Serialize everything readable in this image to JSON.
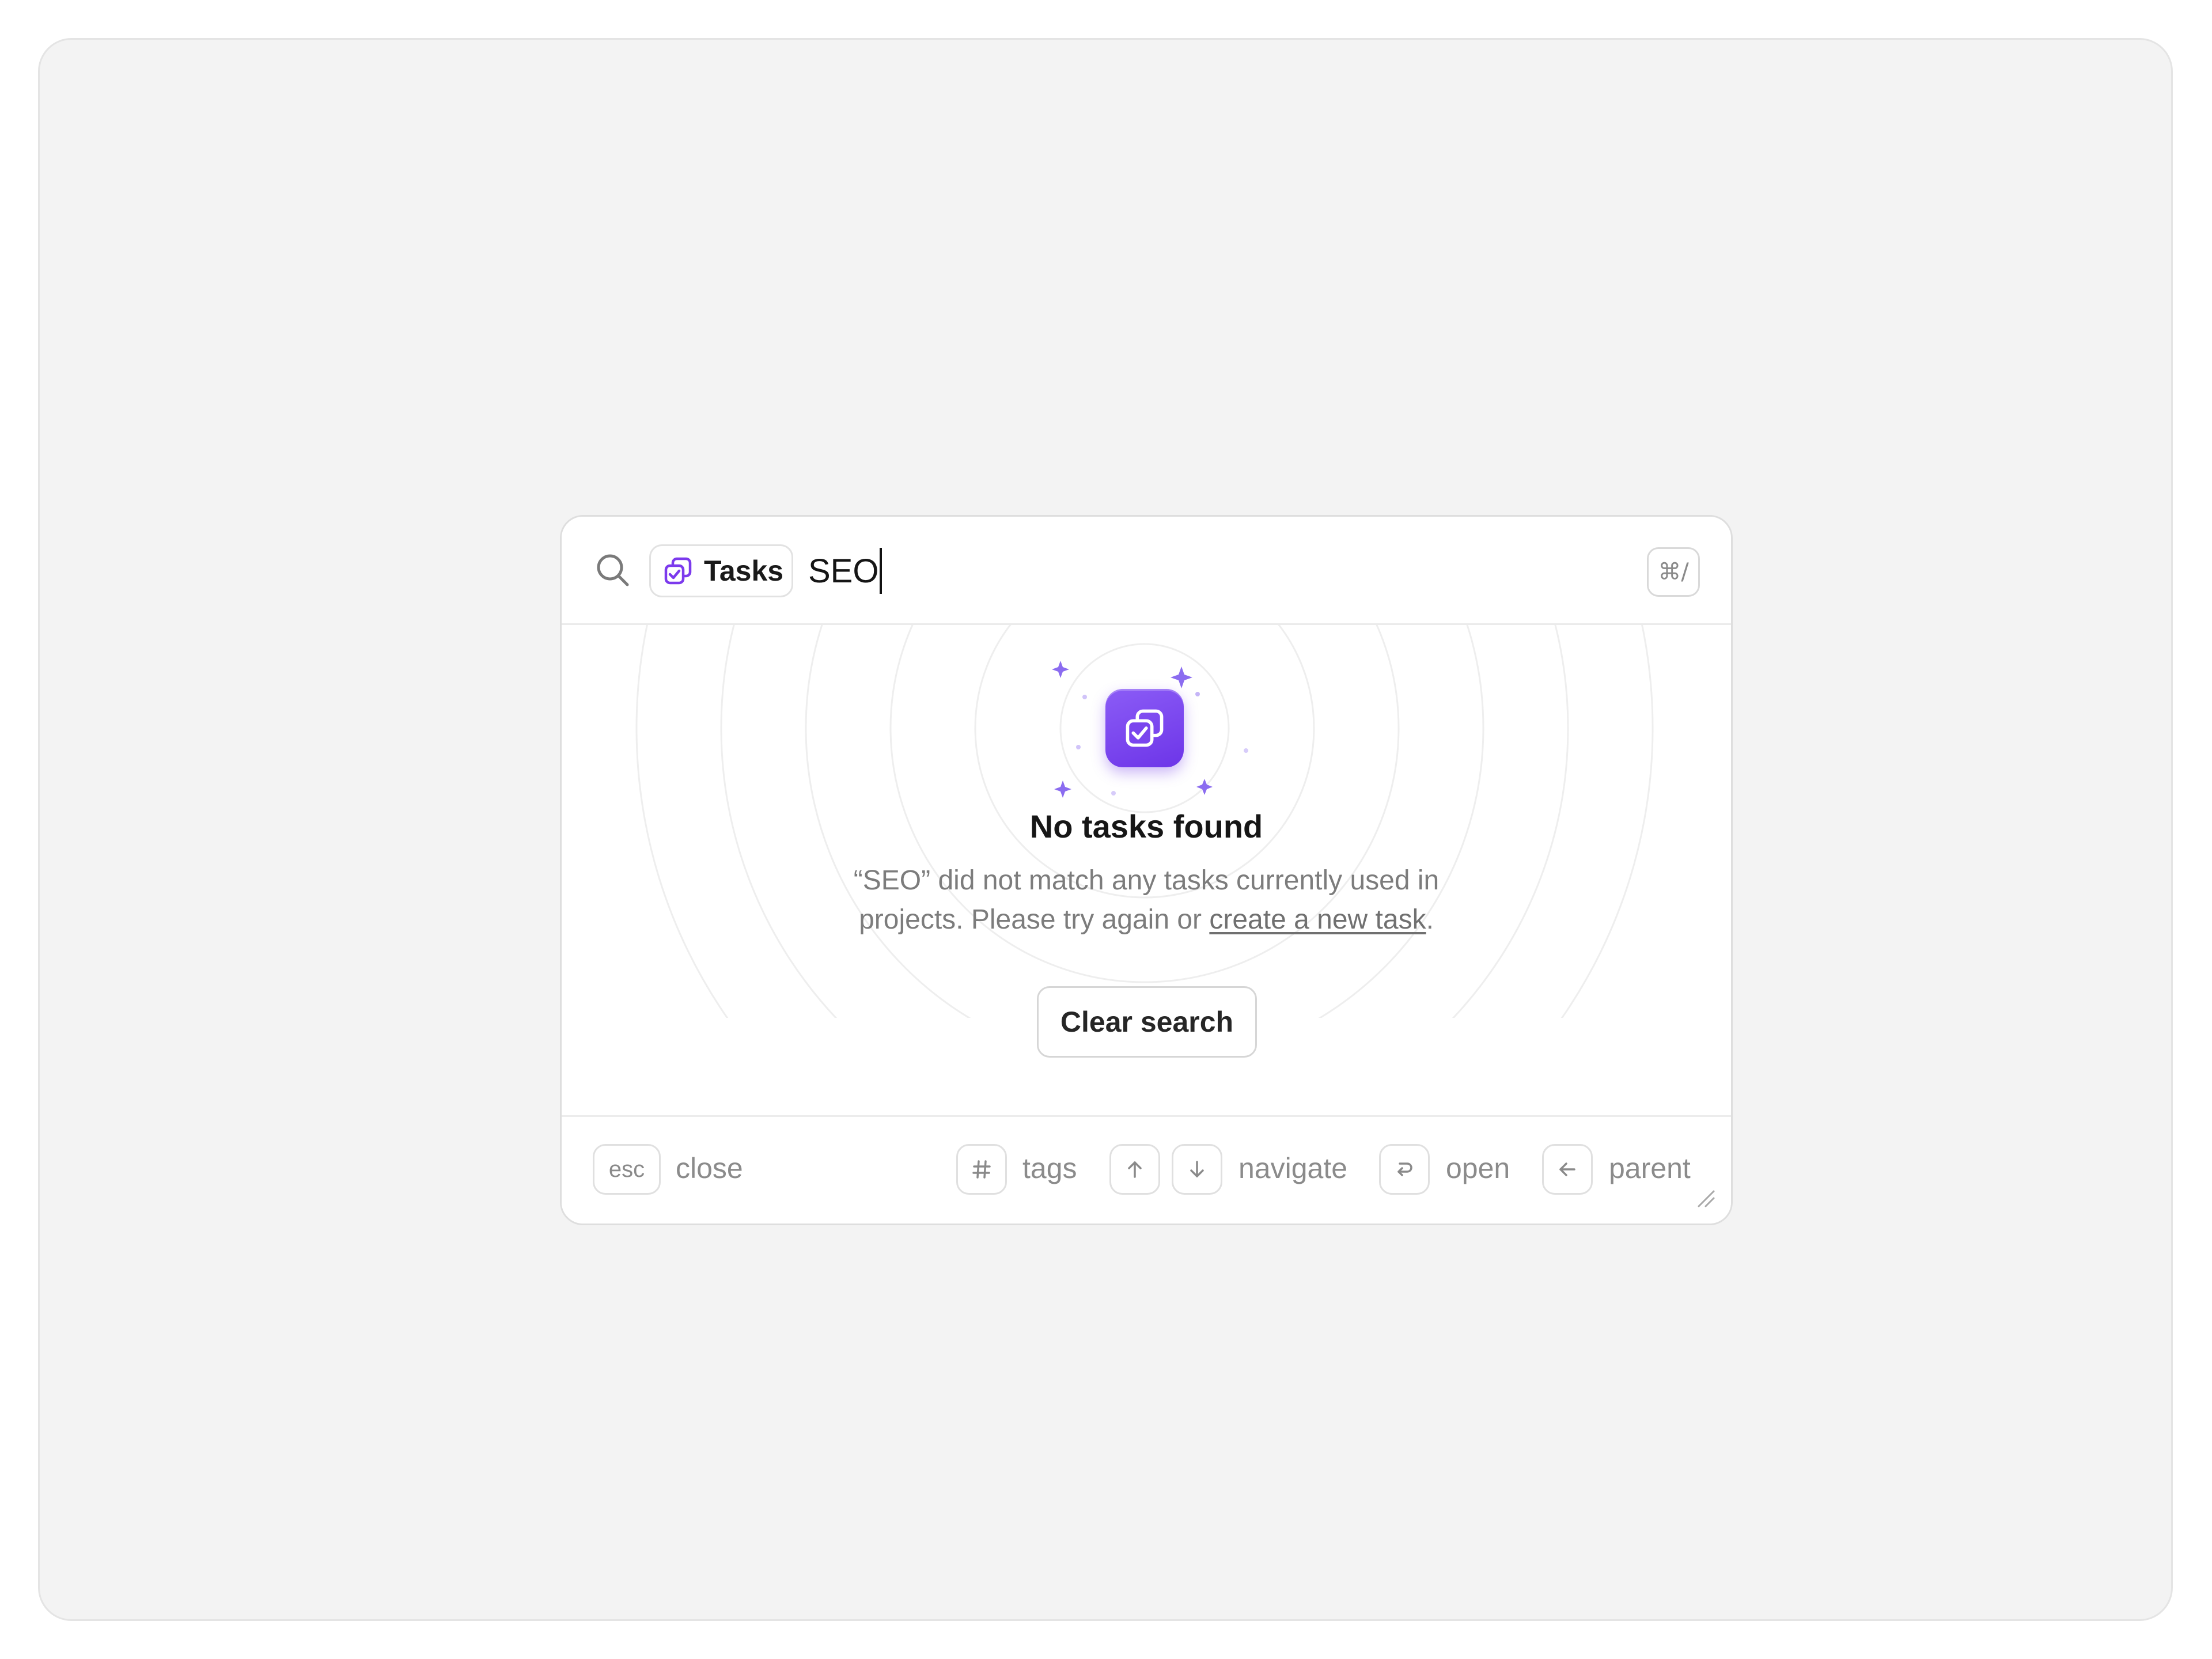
{
  "search": {
    "scope_label": "Tasks",
    "query": "SEO",
    "shortcut": "⌘/"
  },
  "empty_state": {
    "title": "No tasks found",
    "line1": "“SEO” did not match any tasks currently used in",
    "line2_before": "projects. Please try again or ",
    "link_text": "create a new task",
    "line2_after": ".",
    "clear_button": "Clear search"
  },
  "footer": {
    "esc_key": "esc",
    "close_label": "close",
    "tags_label": "tags",
    "navigate_label": "navigate",
    "open_label": "open",
    "parent_label": "parent"
  },
  "colors": {
    "accent": "#7c3aed",
    "badge_gradient_start": "#8b5cf6",
    "badge_gradient_end": "#6d35e8",
    "canvas_background": "#f3f3f3"
  },
  "icons": {
    "search": "search-icon",
    "tasks": "tasks-icon",
    "hash": "hash-icon",
    "up": "arrow-up-icon",
    "down": "arrow-down-icon",
    "enter": "enter-icon",
    "left": "arrow-left-icon",
    "resize": "resize-handle-icon",
    "sparkle": "sparkle-icon"
  }
}
